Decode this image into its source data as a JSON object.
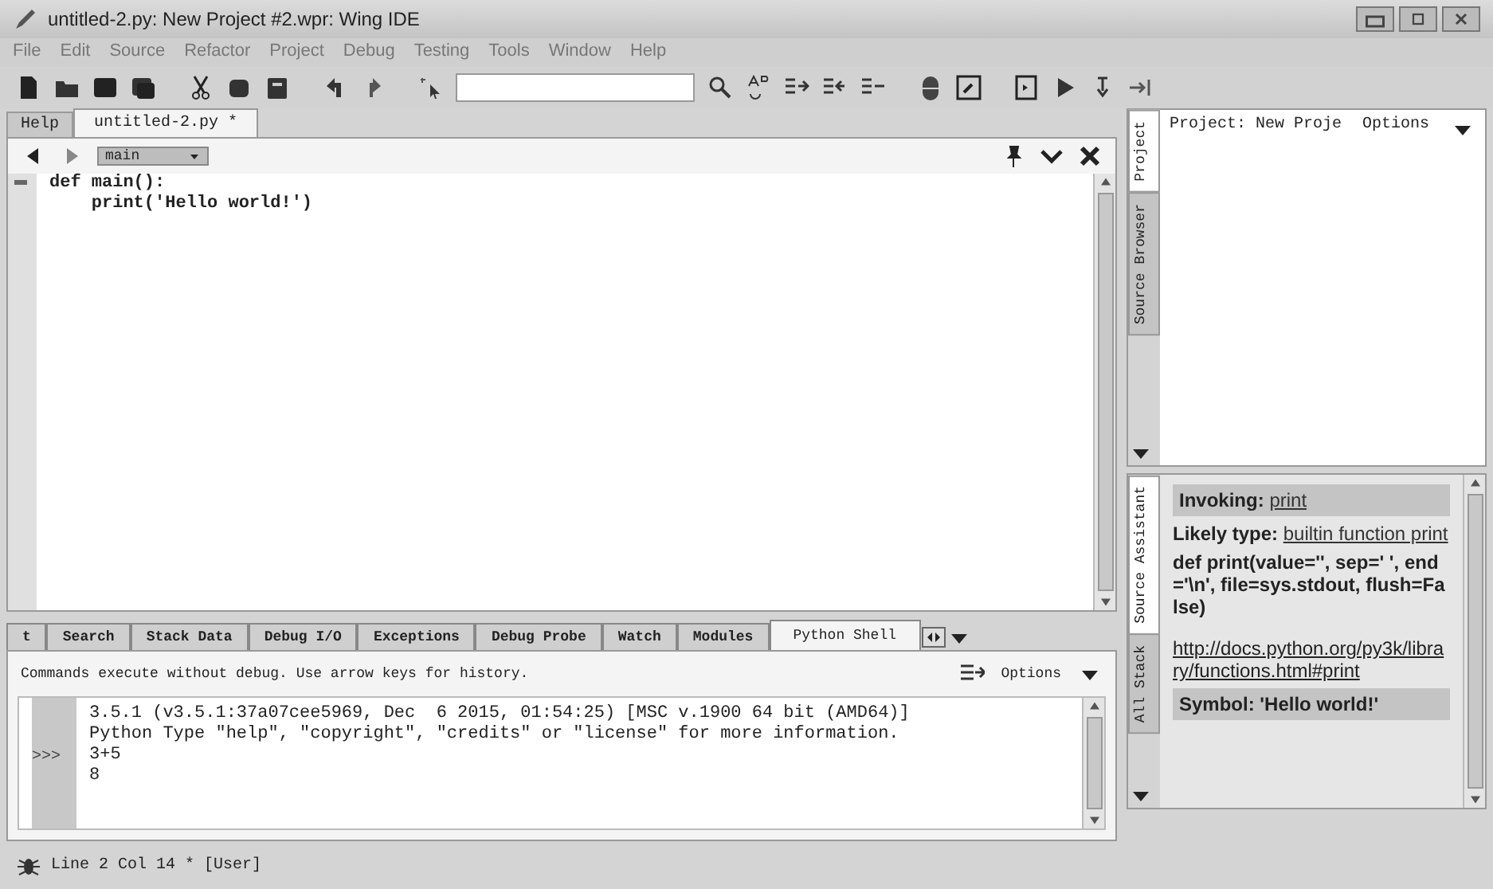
{
  "window": {
    "title": "untitled-2.py: New Project #2.wpr: Wing IDE"
  },
  "menu": [
    "File",
    "Edit",
    "Source",
    "Refactor",
    "Project",
    "Debug",
    "Testing",
    "Tools",
    "Window",
    "Help"
  ],
  "editor": {
    "tabs": [
      {
        "label": "Help",
        "selected": false
      },
      {
        "label": "untitled-2.py *",
        "selected": true
      }
    ],
    "scope": "main",
    "code": [
      {
        "text": "def main():",
        "marker": true
      },
      {
        "text": "    print('Hello world!')",
        "marker": false
      }
    ]
  },
  "bottom_panel": {
    "tabs": [
      {
        "label": "t",
        "selected": false
      },
      {
        "label": "Search",
        "selected": false
      },
      {
        "label": "Stack Data",
        "selected": false
      },
      {
        "label": "Debug I/O",
        "selected": false
      },
      {
        "label": "Exceptions",
        "selected": false
      },
      {
        "label": "Debug Probe",
        "selected": false
      },
      {
        "label": "Watch",
        "selected": false
      },
      {
        "label": "Modules",
        "selected": false
      },
      {
        "label": "Python Shell",
        "selected": true
      }
    ],
    "hint": "Commands execute without debug.  Use arrow keys for history.",
    "options": "Options",
    "lines": [
      {
        "text": "3.5.1 (v3.5.1:37a07cee5969, Dec  6 2015, 01:54:25) [MSC v.1900 64 bit (AMD64)]"
      },
      {
        "text": "Python Type \"help\", \"copyright\", \"credits\" or \"license\" for more information."
      },
      {
        "prompt": ">>>",
        "text": "3+5"
      },
      {
        "text": "8"
      }
    ]
  },
  "project_panel": {
    "tabs": [
      {
        "label": "Project",
        "selected": true
      },
      {
        "label": "Source Browser",
        "selected": false
      }
    ],
    "title": "Project: New Proje",
    "options": "Options"
  },
  "assistant_panel": {
    "tabs": [
      {
        "label": "Source Assistant",
        "selected": true
      },
      {
        "label": "All Stack",
        "selected": false
      }
    ],
    "invoking": {
      "label": "Invoking:",
      "link": "print"
    },
    "likely_type": {
      "label": "Likely type:",
      "link": "builtin function print"
    },
    "signature": "def print(value='', sep=' ', end='\\n', file=sys.stdout, flush=False)",
    "doc_link": "http://docs.python.org/py3k/library/functions.html#print",
    "symbol": "Symbol: 'Hello world!'"
  },
  "status_bar": {
    "text": "Line 2 Col 14 * [User]"
  }
}
